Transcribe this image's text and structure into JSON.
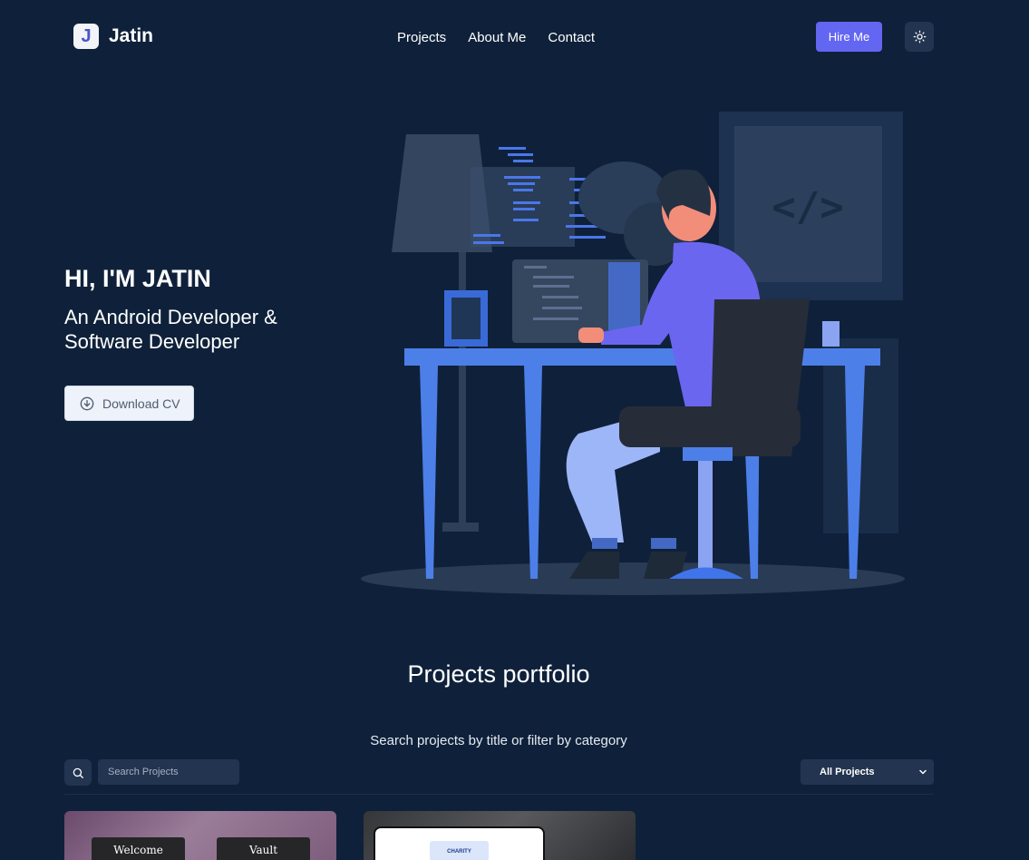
{
  "header": {
    "logo_letter": "J",
    "logo_name": "Jatin",
    "nav": [
      "Projects",
      "About Me",
      "Contact"
    ],
    "hire_label": "Hire Me",
    "theme_icon": "sun-icon"
  },
  "hero": {
    "greeting": "HI, I'M JATIN",
    "role": "An Android Developer & Software Developer",
    "cv_label": "Download CV",
    "cv_icon": "download-circle-icon",
    "illustration_code_symbol": "</>"
  },
  "projects": {
    "title": "Projects portfolio",
    "subtitle": "Search projects by title or filter by category",
    "search_placeholder": "Search Projects",
    "filter_selected": "All Projects",
    "cards": [
      {
        "screens": [
          "Welcome",
          "Vault"
        ]
      },
      {
        "screen_text": "CHARITY"
      }
    ]
  },
  "colors": {
    "background": "#0f213a",
    "accent": "#6366f1",
    "control_bg": "#22344f"
  }
}
